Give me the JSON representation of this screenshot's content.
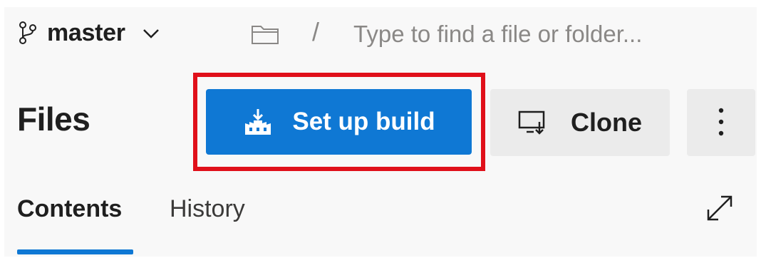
{
  "branch": {
    "name": "master"
  },
  "search": {
    "placeholder": "Type to find a file or folder..."
  },
  "path": {
    "separator": "/"
  },
  "title": "Files",
  "toolbar": {
    "setup_build_label": "Set up build",
    "clone_label": "Clone",
    "more_label": "⋮"
  },
  "tabs": [
    {
      "label": "Contents",
      "selected": true
    },
    {
      "label": "History",
      "selected": false
    }
  ],
  "colors": {
    "accent": "#0f78d4",
    "highlight": "#e0101a",
    "secondary_bg": "#ebebeb"
  },
  "icons": {
    "branch": "git-branch-icon",
    "chevron": "chevron-down-icon",
    "folder": "folder-icon",
    "build": "build-pipeline-icon",
    "clone": "clone-monitor-icon",
    "expand": "expand-icon"
  }
}
